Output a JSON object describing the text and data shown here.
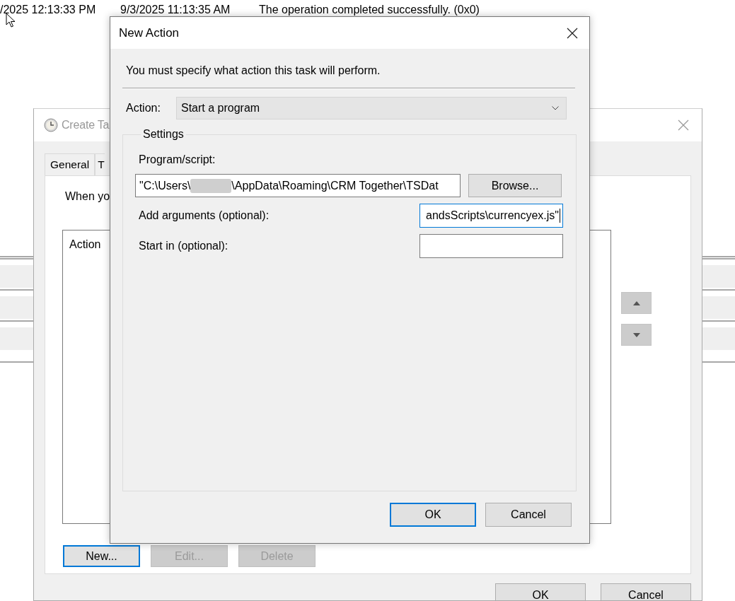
{
  "background_list": {
    "rows": [
      {
        "column_1": "/2025 12:13:33 PM",
        "column_2": "9/3/2025 11:13:35 AM",
        "column_3": "The operation completed successfully. (0x0)"
      }
    ]
  },
  "create_task_window": {
    "title": "Create Ta",
    "active": false,
    "tabs": [
      {
        "label": "General",
        "selected": false
      },
      {
        "label": "T",
        "selected": false
      }
    ],
    "description": "When yo",
    "actions_list": {
      "columns": [
        "Action"
      ]
    },
    "list_buttons": [
      {
        "label": "New...",
        "disabled": false,
        "focused": true
      },
      {
        "label": "Edit...",
        "disabled": true,
        "focused": false
      },
      {
        "label": "Delete",
        "disabled": true,
        "focused": false
      }
    ],
    "buttons": [
      {
        "label": "OK"
      },
      {
        "label": "Cancel"
      }
    ]
  },
  "new_action_dialog": {
    "title": "New Action",
    "instruction": "You must specify what action this task will perform.",
    "action": {
      "label": "Action:",
      "value": "Start a program"
    },
    "settings": {
      "title": "Settings",
      "program": {
        "label": "Program/script:",
        "value": "\"C:\\Users\\",
        "redacted": true,
        "value_after": "\\AppData\\Roaming\\CRM Together\\TSDat",
        "focused": false
      },
      "browse_button": "Browse...",
      "fields": [
        {
          "label": "Add arguments (optional):",
          "value": "andsScripts\\currencyex.js\"",
          "focused": true
        },
        {
          "label": "Start in (optional):",
          "focused": false
        }
      ]
    },
    "buttons": [
      {
        "label": "OK",
        "default": true
      },
      {
        "label": "Cancel",
        "default": false
      }
    ]
  }
}
